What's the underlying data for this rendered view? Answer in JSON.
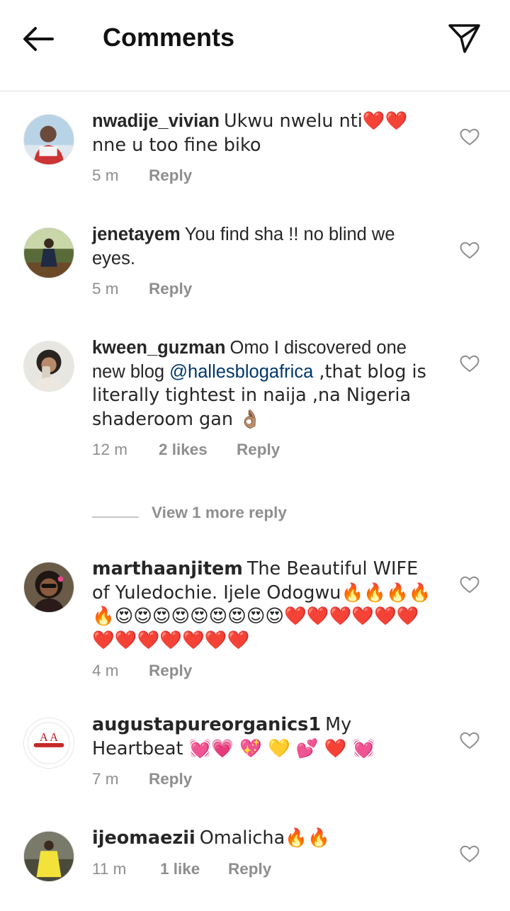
{
  "header": {
    "title": "Comments",
    "back_icon": "arrow-left-icon",
    "send_icon": "paper-plane-icon"
  },
  "comments": [
    {
      "username": "nwadije_vivian",
      "text": "Ukwu nwelu nti❤️❤️nne u too fine biko",
      "time": "5 m",
      "reply": "Reply"
    },
    {
      "username": "jenetayem",
      "text": "You find sha !! no blind we eyes.",
      "time": "5 m",
      "reply": "Reply"
    },
    {
      "username": "kween_guzman",
      "text_before": "Omo I discovered one new blog ",
      "mention": "@hallesblogafrica",
      "text_after": " ,that blog is literally tightest in naija ,na Nigeria shaderoom gan 👌🏽",
      "time": "12 m",
      "likes": "2 likes",
      "reply": "Reply",
      "view_more": "View 1 more reply"
    },
    {
      "username": "marthaanjitem",
      "text": "The Beautiful WIFE of Yuledochie. Ijele Odogwu🔥🔥🔥🔥🔥😍😍😍😍😍😍😍😍😍❤️❤️❤️❤️❤️❤️❤️❤️❤️❤️❤️❤️❤️",
      "time": "4 m",
      "reply": "Reply"
    },
    {
      "username": "augustapureorganics1",
      "text": "My Heartbeat 💓💗 💖 💛 💕 ❤️ 💓",
      "time": "7 m",
      "reply": "Reply",
      "avatar_text": "A A"
    },
    {
      "username": "ijeomaezii",
      "text": "Omalicha🔥🔥",
      "time": "11 m",
      "likes": "1 like",
      "reply": "Reply"
    }
  ],
  "colors": {
    "text": "#262626",
    "muted": "#8e8e8e",
    "mention": "#00376b",
    "divider": "#dbdbdb"
  }
}
